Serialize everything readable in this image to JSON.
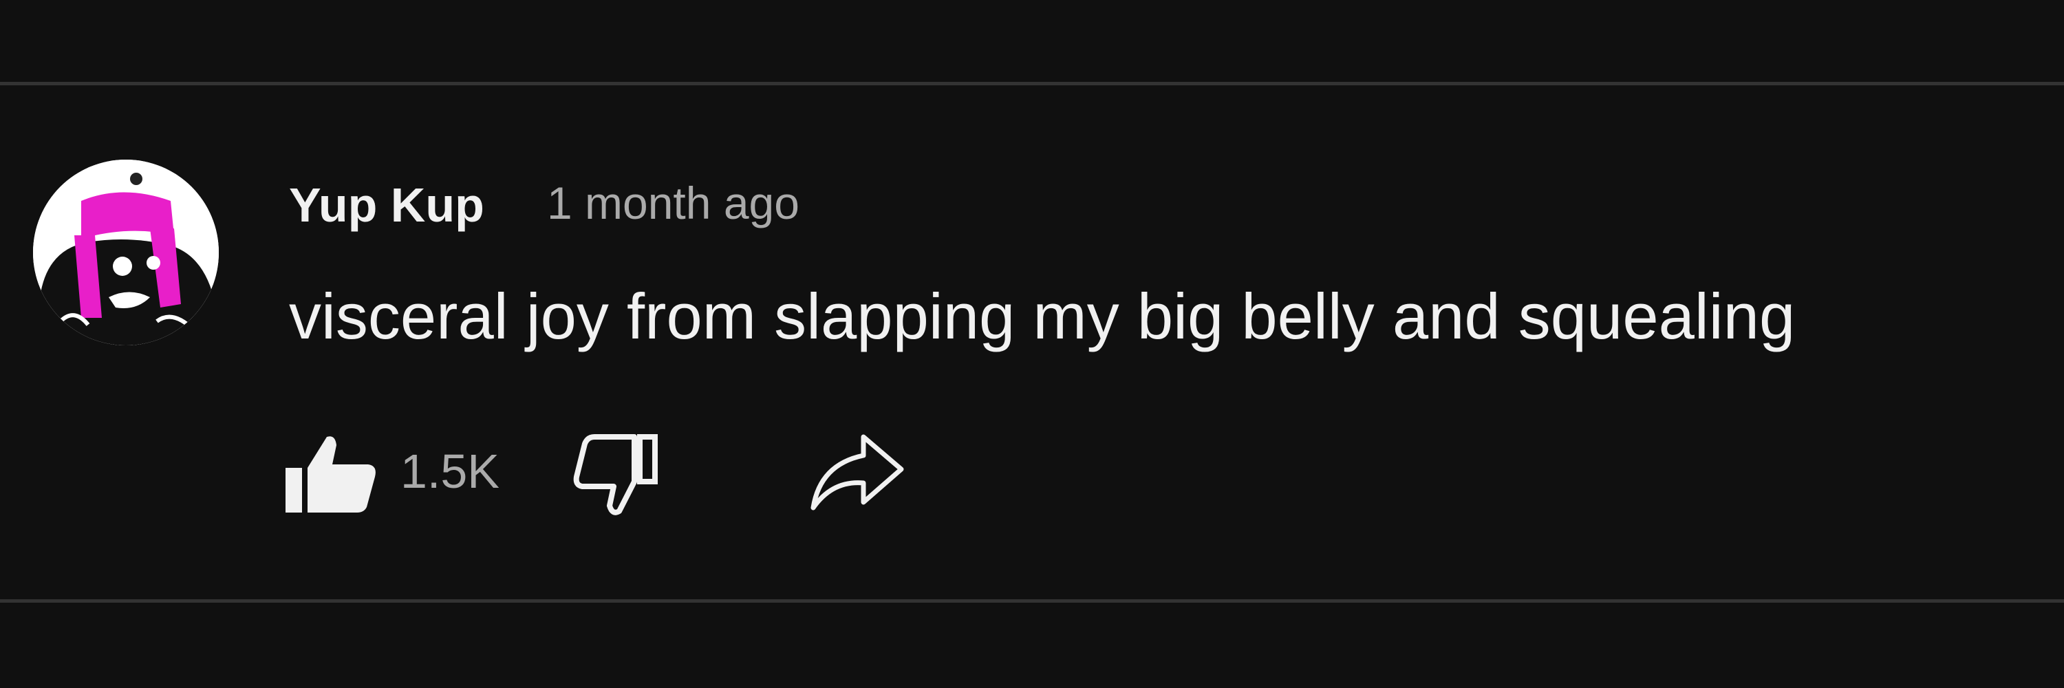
{
  "comment": {
    "author": "Yup Kup",
    "timestamp": "1 month ago",
    "text": "visceral joy from slapping my big belly and squealing",
    "like_count": "1.5K"
  },
  "icons": {
    "like": "thumbs-up-icon",
    "dislike": "thumbs-down-icon",
    "share": "share-arrow-icon"
  },
  "colors": {
    "background": "#101010",
    "divider": "#333333",
    "primary_text": "#f1f1f1",
    "secondary_text": "#aaaaaa",
    "avatar_accent": "#e81fc9"
  }
}
